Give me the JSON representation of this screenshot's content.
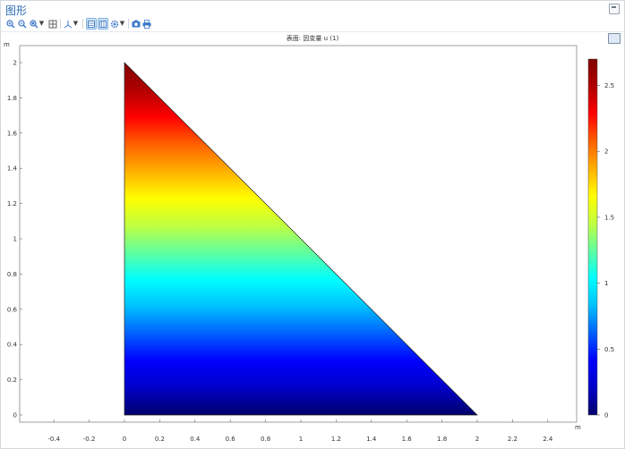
{
  "window": {
    "title": "图形"
  },
  "toolbar": {
    "items": [
      {
        "name": "zoom-in-icon"
      },
      {
        "name": "zoom-out-icon"
      },
      {
        "name": "zoom-box-icon"
      },
      {
        "name": "zoom-extents-icon"
      },
      {
        "name": "axis-orientation-icon"
      },
      {
        "name": "grid-toggle-icon"
      },
      {
        "name": "axis-toggle-icon"
      },
      {
        "name": "settings-icon"
      },
      {
        "name": "camera-icon"
      },
      {
        "name": "print-icon"
      }
    ]
  },
  "plot": {
    "title": "表面: 因变量 u (1)",
    "x_unit": "m",
    "y_unit": "m"
  },
  "chart_data": {
    "type": "heatmap",
    "title": "表面: 因变量 u (1)",
    "xlabel": "m",
    "ylabel": "m",
    "xlim": [
      -0.6,
      2.55
    ],
    "ylim": [
      -0.1,
      2.08
    ],
    "x_ticks": [
      "-0.4",
      "-0.2",
      "0",
      "0.2",
      "0.4",
      "0.6",
      "0.8",
      "1",
      "1.2",
      "1.4",
      "1.6",
      "1.8",
      "2",
      "2.2",
      "2.4"
    ],
    "x_tick_values": [
      -0.4,
      -0.2,
      0,
      0.2,
      0.4,
      0.6,
      0.8,
      1,
      1.2,
      1.4,
      1.6,
      1.8,
      2,
      2.2,
      2.4
    ],
    "y_ticks": [
      "0",
      "0.2",
      "0.4",
      "0.6",
      "0.8",
      "1",
      "1.2",
      "1.4",
      "1.6",
      "1.8",
      "2"
    ],
    "y_tick_values": [
      0,
      0.2,
      0.4,
      0.6,
      0.8,
      1,
      1.2,
      1.4,
      1.6,
      1.8,
      2
    ],
    "domain_vertices": [
      [
        0,
        0
      ],
      [
        2,
        0
      ],
      [
        0,
        2
      ]
    ],
    "field_min": 0,
    "field_max": 2.7,
    "field_description": "u increases from 0 at bottom edge (y=0) to max 2.7 at top vertex (0,2)",
    "colormap": "rainbow",
    "colormap_stops": [
      "#00006a",
      "#0000c8",
      "#0000ff",
      "#0060ff",
      "#00c0ff",
      "#00ffff",
      "#60ff9f",
      "#c0ff40",
      "#ffff00",
      "#ffb000",
      "#ff6000",
      "#ff0000",
      "#b00000",
      "#800000"
    ],
    "colorbar": {
      "ticks": [
        "0",
        "0.5",
        "1",
        "1.5",
        "2",
        "2.5"
      ],
      "tick_values": [
        0,
        0.5,
        1,
        1.5,
        2,
        2.5
      ],
      "min": 0,
      "max": 2.7,
      "placement": "right"
    },
    "grid": false
  }
}
